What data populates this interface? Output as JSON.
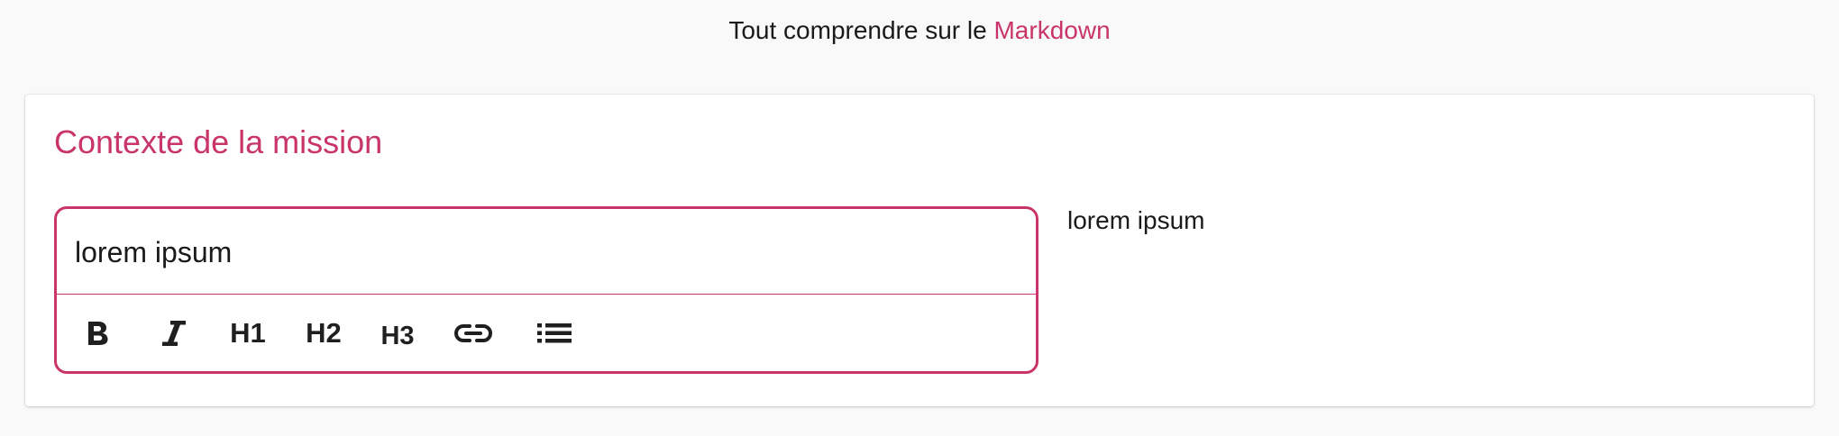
{
  "help": {
    "prefix": "Tout comprendre sur le",
    "link_label": "Markdown"
  },
  "section": {
    "title": "Contexte de la mission"
  },
  "editor": {
    "value": "lorem ipsum",
    "toolbar": {
      "bold_icon": "bold-icon",
      "italic_icon": "italic-icon",
      "h1_label": "H1",
      "h2_label": "H2",
      "h3_label": "H3",
      "link_icon": "link-icon",
      "list_icon": "bulleted-list-icon"
    }
  },
  "preview": {
    "text": "lorem ipsum"
  },
  "colors": {
    "accent": "#c9356a",
    "background": "#f9f9f9",
    "card": "#ffffff",
    "text": "#1a1a1a"
  }
}
